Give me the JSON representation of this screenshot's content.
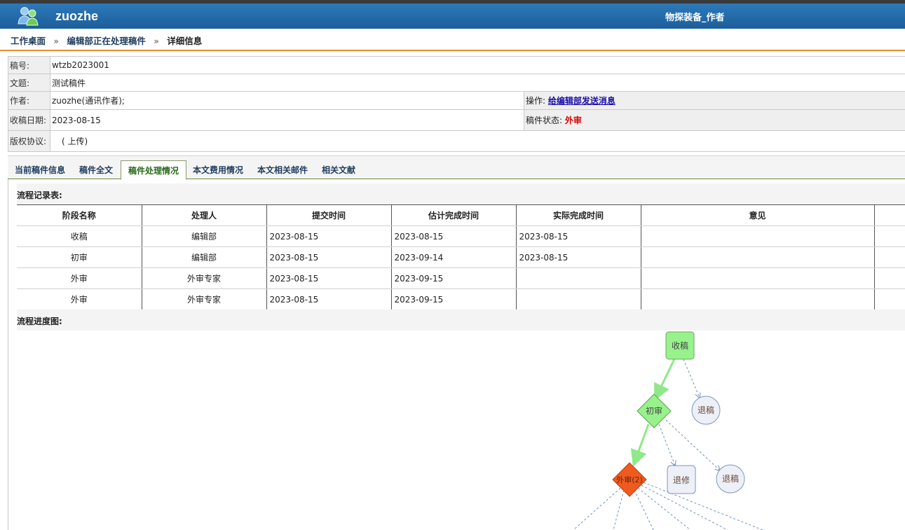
{
  "header": {
    "username": "zuozhe",
    "journal_role": "物探装备_作者"
  },
  "breadcrumb": {
    "items": [
      "工作桌面",
      "编辑部正在处理稿件"
    ],
    "separator": "»",
    "current": "详细信息"
  },
  "manuscript": {
    "id_label": "稿号:",
    "id_value": "wtzb2023001",
    "title_label": "文题:",
    "title_value": "测试稿件",
    "author_label": "作者:",
    "author_value": "zuozhe(通讯作者);",
    "operation_label": "操作:",
    "operation_link": "给编辑部发送消息",
    "received_label": "收稿日期:",
    "received_value": "2023-08-15",
    "status_label": "稿件状态:",
    "status_value": "外审",
    "copyright_label": "版权协议:",
    "copyright_value": "( 上传)"
  },
  "tabs": [
    {
      "label": "当前稿件信息"
    },
    {
      "label": "稿件全文"
    },
    {
      "label": "稿件处理情况"
    },
    {
      "label": "本文费用情况"
    },
    {
      "label": "本文相关邮件"
    },
    {
      "label": "相关文献"
    }
  ],
  "active_tab": "稿件处理情况",
  "flow_records": {
    "title": "流程记录表:",
    "columns": [
      "阶段名称",
      "处理人",
      "提交时间",
      "估计完成时间",
      "实际完成时间",
      "意见"
    ],
    "rows": [
      [
        "收稿",
        "编辑部",
        "2023-08-15",
        "2023-08-15",
        "2023-08-15",
        ""
      ],
      [
        "初审",
        "编辑部",
        "2023-08-15",
        "2023-09-14",
        "2023-08-15",
        ""
      ],
      [
        "外审",
        "外审专家",
        "2023-08-15",
        "2023-09-15",
        "",
        ""
      ],
      [
        "外审",
        "外审专家",
        "2023-08-15",
        "2023-09-15",
        "",
        ""
      ]
    ]
  },
  "flow_diagram": {
    "title": "流程进度图:",
    "nodes": {
      "received": "收稿",
      "reject_1": "退稿",
      "initial_review": "初审",
      "reject_2": "退稿",
      "revise": "退修",
      "reject_3": "退稿",
      "external_review": "外审(2)"
    },
    "colors": {
      "done": "#98f28c",
      "current": "#f05a1e",
      "pending": "#eef0f8",
      "active_edge": "#8fe88a",
      "pending_edge": "#6f8fc0"
    }
  }
}
